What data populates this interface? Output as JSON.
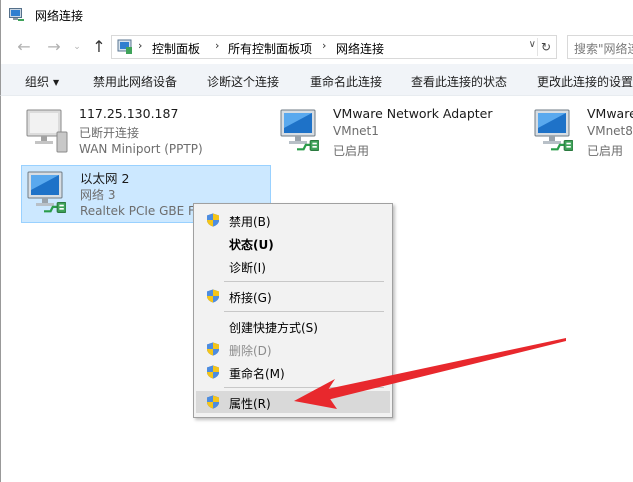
{
  "window": {
    "title": "网络连接"
  },
  "nav": {
    "breadcrumbs": [
      "控制面板",
      "所有控制面板项",
      "网络连接"
    ],
    "search_placeholder": "搜索\"网络连"
  },
  "commands": [
    "组织",
    "禁用此网络设备",
    "诊断这个连接",
    "重命名此连接",
    "查看此连接的状态",
    "更改此连接的设置"
  ],
  "adapters": [
    {
      "name": "117.25.130.187",
      "status": "已断开连接",
      "device": "WAN Miniport (PPTP)"
    },
    {
      "name": "VMware Network Adapter",
      "status": "VMnet1",
      "device": "已启用"
    },
    {
      "name": "VMware",
      "status": "VMnet8",
      "device": "已启用"
    },
    {
      "name": "以太网 2",
      "status": "网络 3",
      "device": "Realtek PCIe GBE Fa"
    }
  ],
  "context_menu": {
    "items": [
      {
        "label": "禁用(B)",
        "shield": true,
        "bold": false,
        "disabled": false
      },
      {
        "label": "状态(U)",
        "shield": false,
        "bold": true,
        "disabled": false
      },
      {
        "label": "诊断(I)",
        "shield": false,
        "bold": false,
        "disabled": false
      },
      {
        "label": "桥接(G)",
        "shield": true,
        "bold": false,
        "disabled": false
      },
      {
        "label": "创建快捷方式(S)",
        "shield": false,
        "bold": false,
        "disabled": false
      },
      {
        "label": "删除(D)",
        "shield": true,
        "bold": false,
        "disabled": true
      },
      {
        "label": "重命名(M)",
        "shield": true,
        "bold": false,
        "disabled": false
      },
      {
        "label": "属性(R)",
        "shield": true,
        "bold": false,
        "disabled": false,
        "highlighted": true
      }
    ]
  },
  "colors": {
    "selection": "#cce8ff",
    "arrow": "#e8282d",
    "cmdbar": "#f1f4f8"
  }
}
